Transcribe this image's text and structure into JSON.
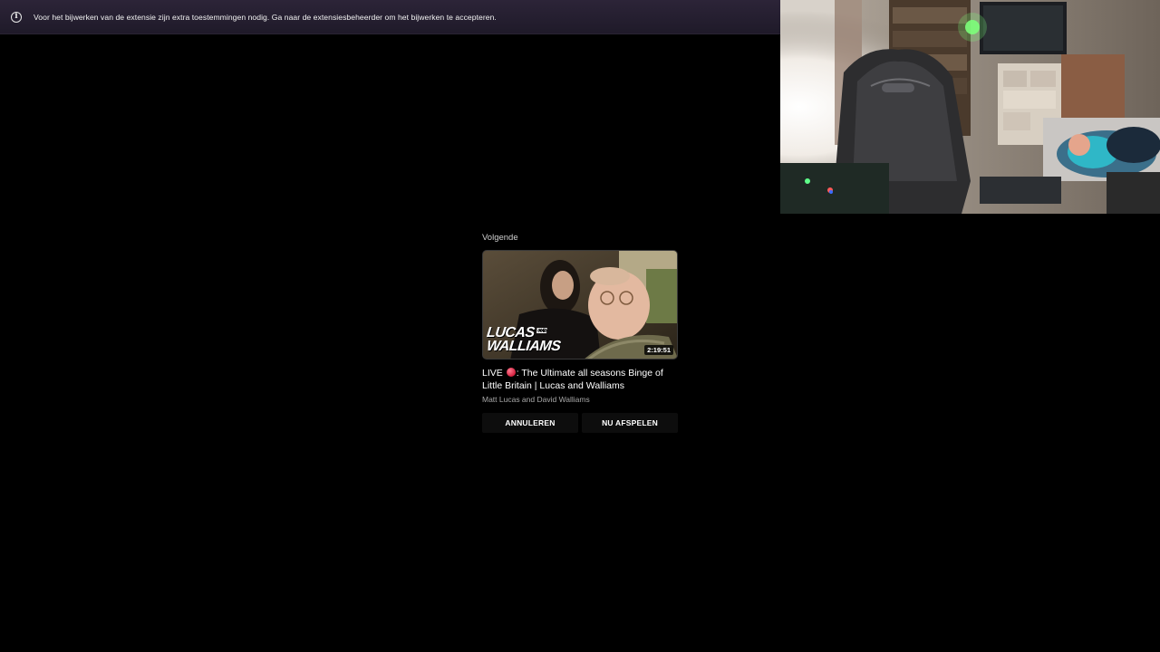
{
  "notification": {
    "icon": "info-icon",
    "icon_glyph": "i",
    "message": "Voor het bijwerken van de extensie zijn extra toestemmingen nodig. Ga naar de extensiesbeheerder om het bijwerken te accepteren."
  },
  "webcam": {
    "description_icon": "webcam-feed"
  },
  "up_next": {
    "label": "Volgende",
    "thumbnail": {
      "brand_line1": "LUCAS",
      "brand_and": "AND",
      "brand_line2": "WALLIAMS",
      "duration": "2:19:51"
    },
    "title_prefix": "LIVE",
    "title_suffix": ": The Ultimate all seasons Binge of Little Britain | Lucas and Walliams",
    "channel": "Matt Lucas and David Walliams",
    "cancel_label": "ANNULEREN",
    "play_now_label": "NU AFSPELEN"
  },
  "colors": {
    "background": "#000000",
    "notice_bar": "#2c2438",
    "live_dot": "#d21e3c"
  }
}
